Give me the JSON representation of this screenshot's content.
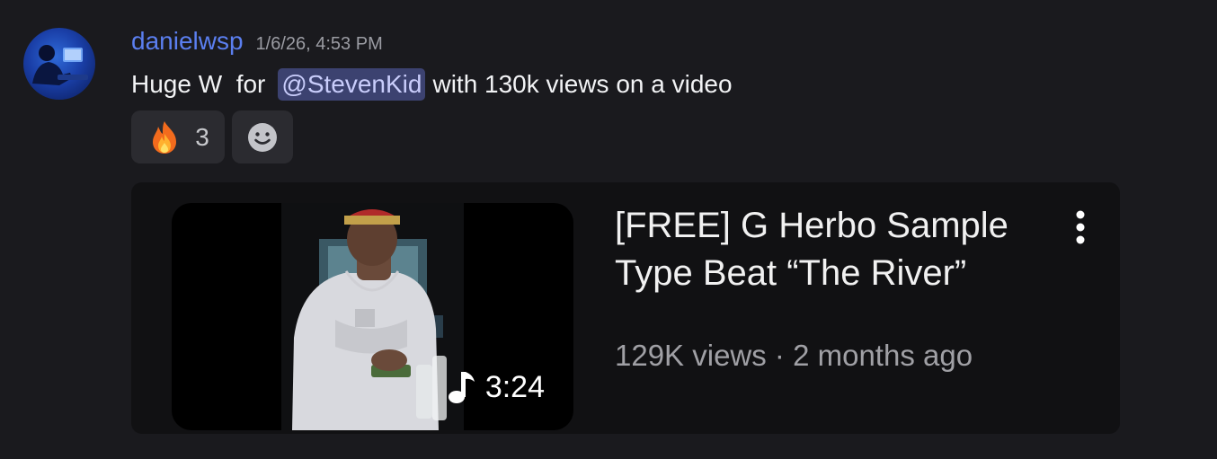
{
  "message": {
    "author": "danielwsp",
    "timestamp": "1/6/26, 4:53 PM",
    "text_before": "Huge W  for",
    "mention": "@StevenKid",
    "text_after": "with 130k views on a video",
    "avatar_icon": "avatar-photo"
  },
  "reactions": [
    {
      "emoji": "fire-emoji",
      "count": "3"
    },
    {
      "icon": "add-reaction-smile-icon"
    }
  ],
  "embed": {
    "title": "[FREE] G Herbo Sample Type Beat “The River”",
    "meta": "129K views · 2 months ago",
    "duration": "3:24",
    "duration_icon": "music-note-icon",
    "menu_icon": "more-vertical-icon"
  },
  "colors": {
    "background": "#1a1a1e",
    "username": "#5b7ff0",
    "mention_bg": "#3c4270",
    "embed_bg": "#111113"
  }
}
